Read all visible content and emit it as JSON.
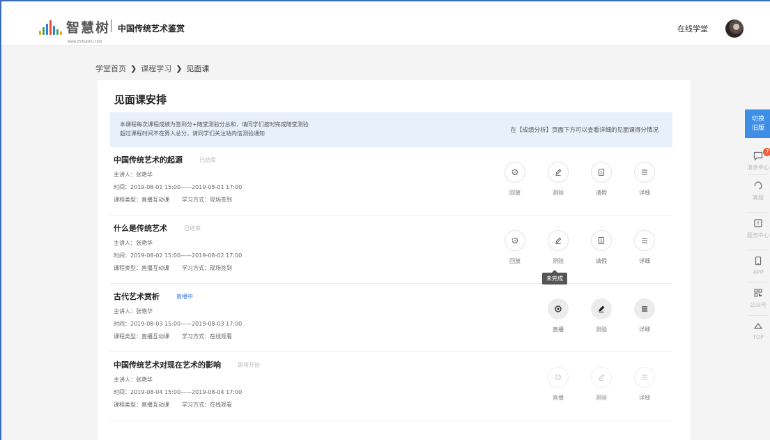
{
  "header": {
    "logo_text": "智慧树",
    "logo_sub": "www.zhihuishu.com",
    "course_title": "中国传统艺术鉴赏",
    "online_link": "在线学堂"
  },
  "breadcrumb": [
    "学堂首页",
    "课程学习",
    "见面课"
  ],
  "page": {
    "title": "见面课安排",
    "notice_line1": "本课程每次课程成绩为签到分+随堂测验分总和，请同学们按时完成随堂测验",
    "notice_line2": "超过课程时间不在算入总分，请同学们关注站内信测验通知",
    "notice_right": "在【成绩分析】页面下方可以查看详细的见面课得分情况"
  },
  "sessions": [
    {
      "title": "中国传统艺术的起源",
      "status": "已结束",
      "speaker": "主讲人：张艳华",
      "time": "时间：2019-08-01 15:00——2019-08-01 17:00",
      "type": "课程类型：直播互动课",
      "mode": "学习方式：现场签到",
      "actions": [
        "回放",
        "测验",
        "请假",
        "详细"
      ]
    },
    {
      "title": "什么是传统艺术",
      "status": "已结束",
      "speaker": "主讲人：张艳华",
      "time": "时间：2019-08-02 15:00——2019-08-02 17:00",
      "type": "课程类型：直播互动课",
      "mode": "学习方式：现场签到",
      "actions": [
        "回放",
        "测验",
        "请假",
        "详细"
      ]
    },
    {
      "title": "古代艺术赏析",
      "status": "直播中",
      "speaker": "主讲人：张艳华",
      "time": "时间：2019-08-03 15:00——2019-08-03 17:00",
      "type": "课程类型：直播互动课",
      "mode": "学习方式：在线观看",
      "actions": [
        "直播",
        "测验",
        "详细"
      ]
    },
    {
      "title": "中国传统艺术对现在艺术的影响",
      "status": "即将开始",
      "speaker": "主讲人：张艳华",
      "time": "时间：2019-08-04 15:00——2019-08-04 17:00",
      "type": "课程类型：直播互动课",
      "mode": "学习方式：在线观看",
      "actions": [
        "直播",
        "测验",
        "详细"
      ]
    }
  ],
  "tooltip": "未完成",
  "sidebar": {
    "switch_line1": "切换",
    "switch_line2": "旧版",
    "badge": "7",
    "items": [
      "消息中心",
      "客服",
      "服务中心",
      "APP",
      "公众号",
      "TOP"
    ]
  },
  "colors": {
    "accent": "#3e8ee6",
    "live": "#3a7bd5",
    "badge": "#f25a3c",
    "notice_bg": "#e8f1fb"
  }
}
